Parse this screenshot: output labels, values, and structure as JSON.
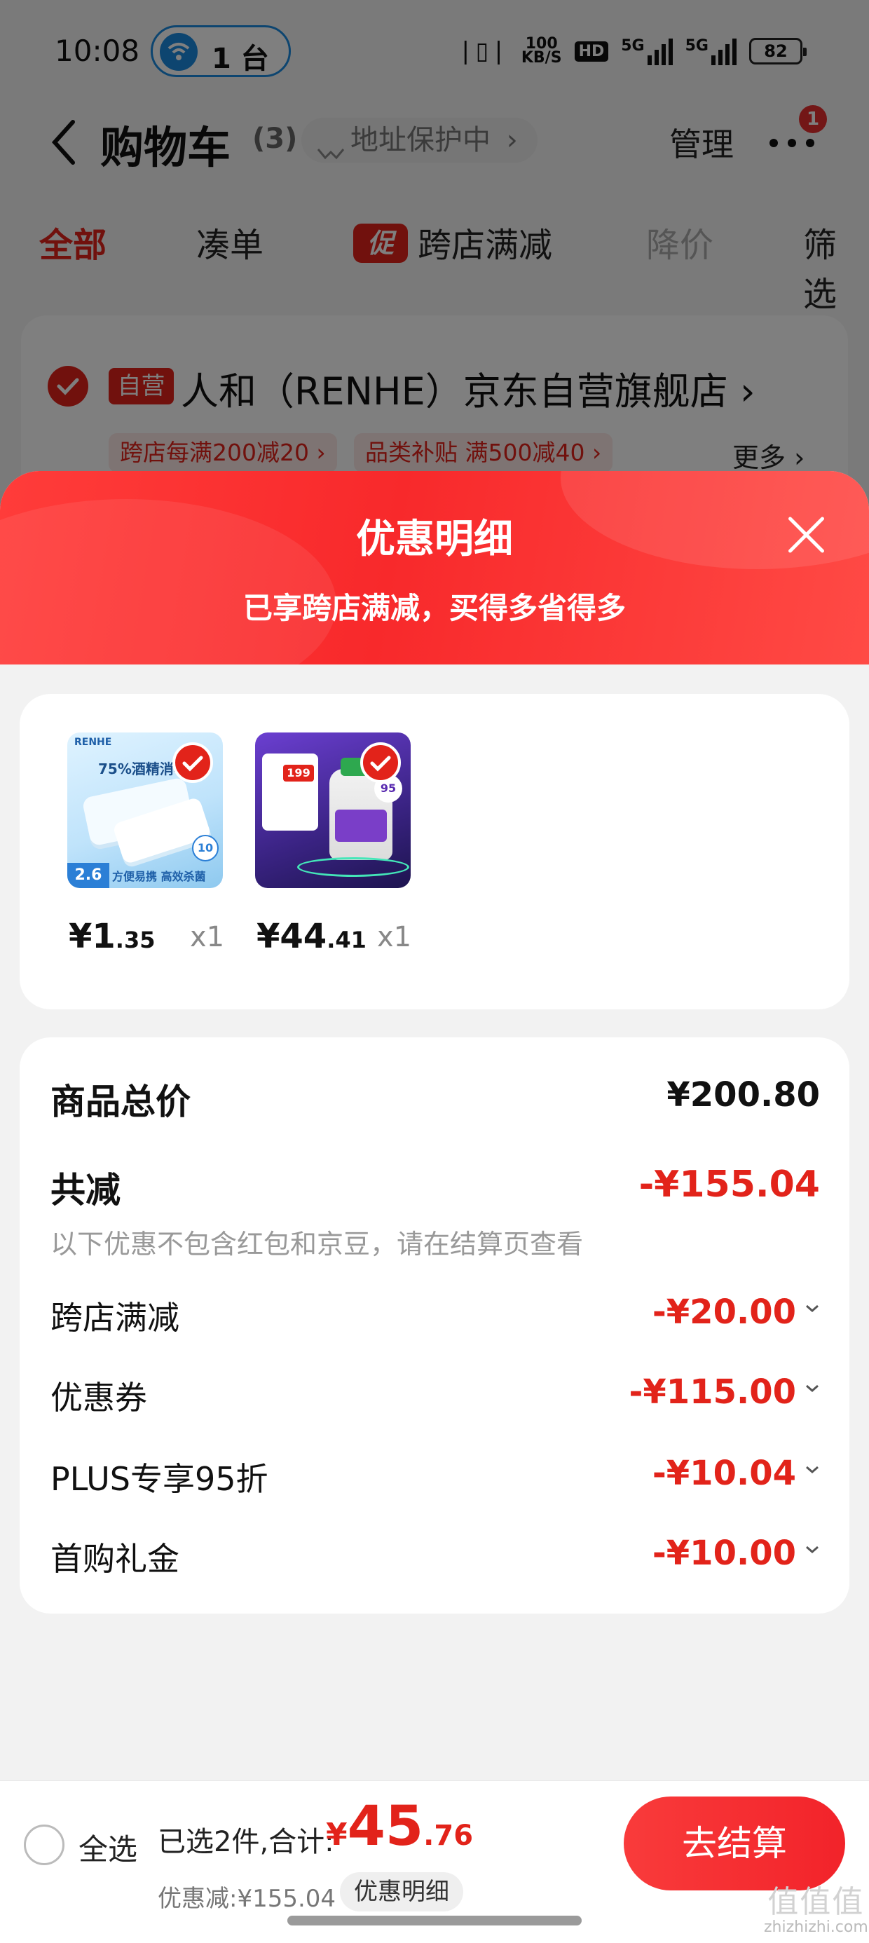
{
  "status_bar": {
    "time": "10:08",
    "hotspot_label": "1 台",
    "net_speed": "100\nKB/S",
    "hd_label": "HD",
    "sig1_label": "5G",
    "sig2_label": "5G",
    "battery": "82"
  },
  "nav": {
    "title": "购物车",
    "count": "(3)",
    "address_protect": "地址保护中",
    "manage": "管理",
    "more_badge": "1"
  },
  "tabs": [
    {
      "label": "全部",
      "state": "active"
    },
    {
      "label": "凑单",
      "state": "normal"
    },
    {
      "label": "跨店满减",
      "state": "normal",
      "tag": "促"
    },
    {
      "label": "降价",
      "state": "disabled"
    },
    {
      "label": "筛选",
      "state": "normal"
    }
  ],
  "store": {
    "self_tag": "自营",
    "name": "人和（RENHE）京东自营旗舰店",
    "chips": [
      "跨店每满200减20",
      "品类补贴 满500减40"
    ],
    "more": "更多"
  },
  "sheet": {
    "title": "优惠明细",
    "subtitle": "已享跨店满减，买得多省得多"
  },
  "products": [
    {
      "price_int": "¥1",
      "price_dec": ".35",
      "qty": "x1",
      "thumb_brand": "RENHE",
      "thumb_text": "75%酒精消毒",
      "thumb_num": "2.6",
      "thumb_tags": "方便易携 高效杀菌",
      "thumb_count": "10"
    },
    {
      "price_int": "¥44",
      "price_dec": ".41",
      "qty": "x1",
      "thumb_price": "199",
      "thumb_discount": "95"
    }
  ],
  "summary": {
    "total_label": "商品总价",
    "total_value": "¥200.80",
    "reduce_label": "共减",
    "reduce_value": "-¥155.04",
    "hint": "以下优惠不包含红包和京豆，请在结算页查看",
    "items": [
      {
        "label": "跨店满减",
        "value": "-¥20.00"
      },
      {
        "label": "优惠券",
        "value": "-¥115.00"
      },
      {
        "label": "PLUS专享95折",
        "value": "-¥10.04"
      },
      {
        "label": "首购礼金",
        "value": "-¥10.00"
      }
    ]
  },
  "bottom": {
    "select_all": "全选",
    "selected_text": "已选2件,合计:",
    "currency": "¥",
    "total_int": "45",
    "total_dec": ".76",
    "discount_text": "优惠减:¥155.04",
    "detail_button": "优惠明细",
    "checkout": "去结算"
  },
  "watermark": {
    "mark": "值值值",
    "site": "zhizhizhi.com"
  },
  "colors": {
    "accent": "#e2231a",
    "gradient_start": "#ff3c3a",
    "gradient_end": "#ff4a45"
  }
}
